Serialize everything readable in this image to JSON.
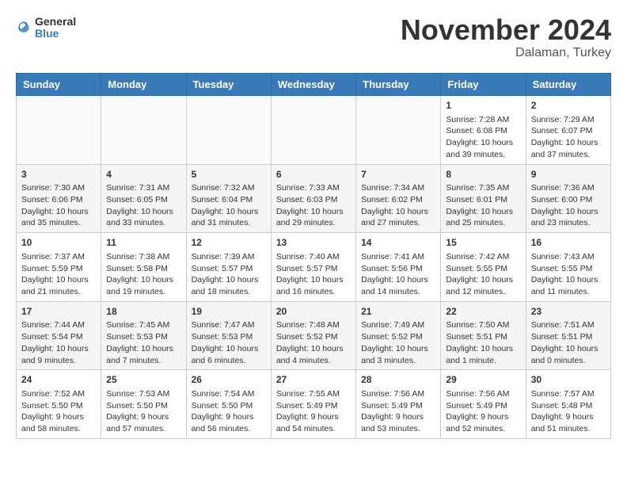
{
  "app": {
    "logo_line1": "General",
    "logo_line2": "Blue"
  },
  "header": {
    "month": "November 2024",
    "location": "Dalaman, Turkey"
  },
  "weekdays": [
    "Sunday",
    "Monday",
    "Tuesday",
    "Wednesday",
    "Thursday",
    "Friday",
    "Saturday"
  ],
  "weeks": [
    {
      "rowClass": "week-row-1",
      "days": [
        {
          "date": "",
          "content": ""
        },
        {
          "date": "",
          "content": ""
        },
        {
          "date": "",
          "content": ""
        },
        {
          "date": "",
          "content": ""
        },
        {
          "date": "",
          "content": ""
        },
        {
          "date": "1",
          "content": "Sunrise: 7:28 AM\nSunset: 6:08 PM\nDaylight: 10 hours\nand 39 minutes."
        },
        {
          "date": "2",
          "content": "Sunrise: 7:29 AM\nSunset: 6:07 PM\nDaylight: 10 hours\nand 37 minutes."
        }
      ]
    },
    {
      "rowClass": "week-row-2",
      "days": [
        {
          "date": "3",
          "content": "Sunrise: 7:30 AM\nSunset: 6:06 PM\nDaylight: 10 hours\nand 35 minutes."
        },
        {
          "date": "4",
          "content": "Sunrise: 7:31 AM\nSunset: 6:05 PM\nDaylight: 10 hours\nand 33 minutes."
        },
        {
          "date": "5",
          "content": "Sunrise: 7:32 AM\nSunset: 6:04 PM\nDaylight: 10 hours\nand 31 minutes."
        },
        {
          "date": "6",
          "content": "Sunrise: 7:33 AM\nSunset: 6:03 PM\nDaylight: 10 hours\nand 29 minutes."
        },
        {
          "date": "7",
          "content": "Sunrise: 7:34 AM\nSunset: 6:02 PM\nDaylight: 10 hours\nand 27 minutes."
        },
        {
          "date": "8",
          "content": "Sunrise: 7:35 AM\nSunset: 6:01 PM\nDaylight: 10 hours\nand 25 minutes."
        },
        {
          "date": "9",
          "content": "Sunrise: 7:36 AM\nSunset: 6:00 PM\nDaylight: 10 hours\nand 23 minutes."
        }
      ]
    },
    {
      "rowClass": "week-row-3",
      "days": [
        {
          "date": "10",
          "content": "Sunrise: 7:37 AM\nSunset: 5:59 PM\nDaylight: 10 hours\nand 21 minutes."
        },
        {
          "date": "11",
          "content": "Sunrise: 7:38 AM\nSunset: 5:58 PM\nDaylight: 10 hours\nand 19 minutes."
        },
        {
          "date": "12",
          "content": "Sunrise: 7:39 AM\nSunset: 5:57 PM\nDaylight: 10 hours\nand 18 minutes."
        },
        {
          "date": "13",
          "content": "Sunrise: 7:40 AM\nSunset: 5:57 PM\nDaylight: 10 hours\nand 16 minutes."
        },
        {
          "date": "14",
          "content": "Sunrise: 7:41 AM\nSunset: 5:56 PM\nDaylight: 10 hours\nand 14 minutes."
        },
        {
          "date": "15",
          "content": "Sunrise: 7:42 AM\nSunset: 5:55 PM\nDaylight: 10 hours\nand 12 minutes."
        },
        {
          "date": "16",
          "content": "Sunrise: 7:43 AM\nSunset: 5:55 PM\nDaylight: 10 hours\nand 11 minutes."
        }
      ]
    },
    {
      "rowClass": "week-row-4",
      "days": [
        {
          "date": "17",
          "content": "Sunrise: 7:44 AM\nSunset: 5:54 PM\nDaylight: 10 hours\nand 9 minutes."
        },
        {
          "date": "18",
          "content": "Sunrise: 7:45 AM\nSunset: 5:53 PM\nDaylight: 10 hours\nand 7 minutes."
        },
        {
          "date": "19",
          "content": "Sunrise: 7:47 AM\nSunset: 5:53 PM\nDaylight: 10 hours\nand 6 minutes."
        },
        {
          "date": "20",
          "content": "Sunrise: 7:48 AM\nSunset: 5:52 PM\nDaylight: 10 hours\nand 4 minutes."
        },
        {
          "date": "21",
          "content": "Sunrise: 7:49 AM\nSunset: 5:52 PM\nDaylight: 10 hours\nand 3 minutes."
        },
        {
          "date": "22",
          "content": "Sunrise: 7:50 AM\nSunset: 5:51 PM\nDaylight: 10 hours\nand 1 minute."
        },
        {
          "date": "23",
          "content": "Sunrise: 7:51 AM\nSunset: 5:51 PM\nDaylight: 10 hours\nand 0 minutes."
        }
      ]
    },
    {
      "rowClass": "week-row-5",
      "days": [
        {
          "date": "24",
          "content": "Sunrise: 7:52 AM\nSunset: 5:50 PM\nDaylight: 9 hours\nand 58 minutes."
        },
        {
          "date": "25",
          "content": "Sunrise: 7:53 AM\nSunset: 5:50 PM\nDaylight: 9 hours\nand 57 minutes."
        },
        {
          "date": "26",
          "content": "Sunrise: 7:54 AM\nSunset: 5:50 PM\nDaylight: 9 hours\nand 56 minutes."
        },
        {
          "date": "27",
          "content": "Sunrise: 7:55 AM\nSunset: 5:49 PM\nDaylight: 9 hours\nand 54 minutes."
        },
        {
          "date": "28",
          "content": "Sunrise: 7:56 AM\nSunset: 5:49 PM\nDaylight: 9 hours\nand 53 minutes."
        },
        {
          "date": "29",
          "content": "Sunrise: 7:56 AM\nSunset: 5:49 PM\nDaylight: 9 hours\nand 52 minutes."
        },
        {
          "date": "30",
          "content": "Sunrise: 7:57 AM\nSunset: 5:48 PM\nDaylight: 9 hours\nand 51 minutes."
        }
      ]
    }
  ]
}
